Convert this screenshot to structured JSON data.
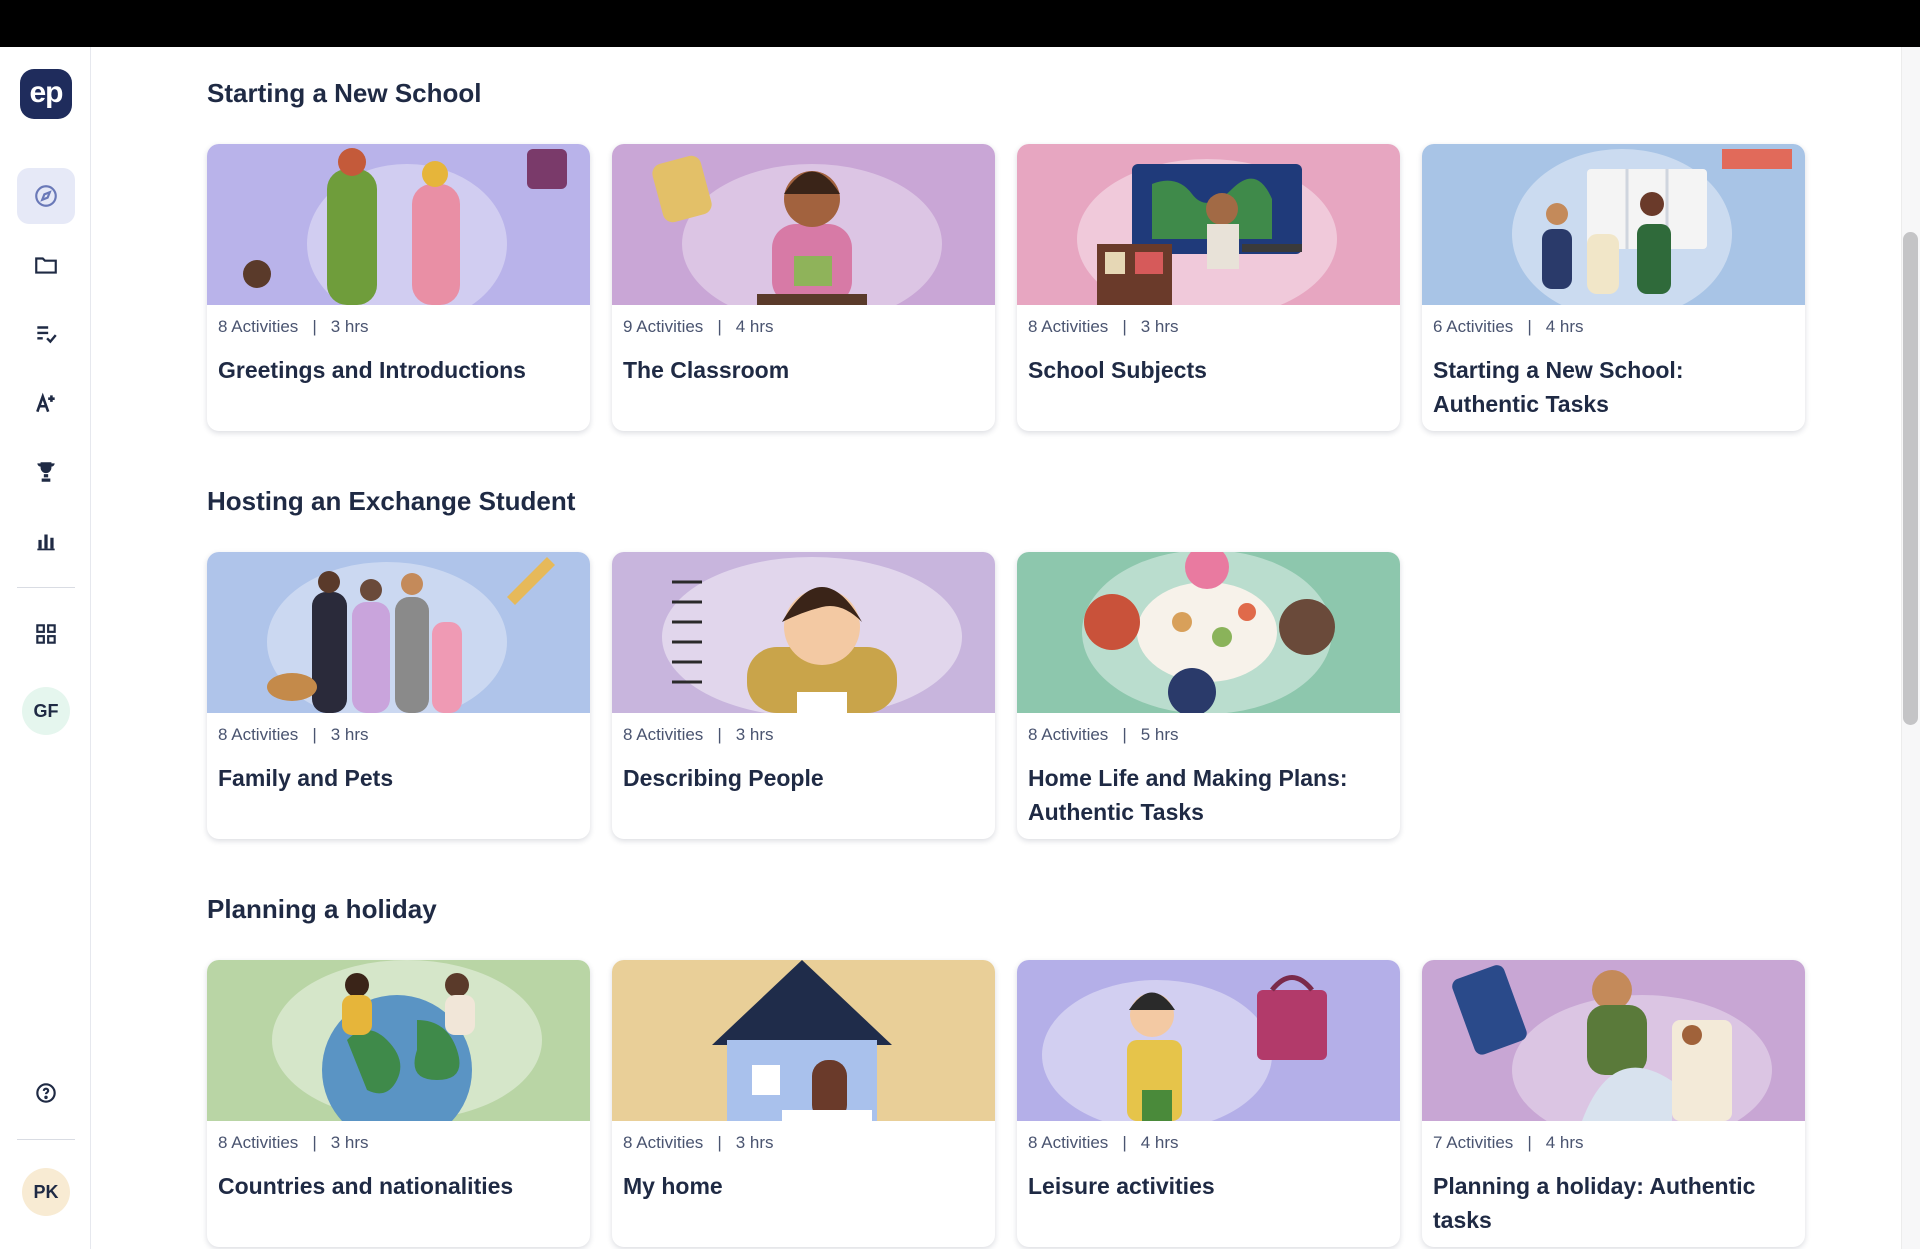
{
  "sidebar": {
    "logo": "ep",
    "nav": [
      {
        "icon": "compass-icon",
        "active": true
      },
      {
        "icon": "folder-icon",
        "active": false
      },
      {
        "icon": "checklist-icon",
        "active": false
      },
      {
        "icon": "a-plus-icon",
        "active": false
      },
      {
        "icon": "trophy-icon",
        "active": false
      },
      {
        "icon": "bar-chart-icon",
        "active": false
      },
      {
        "icon": "grid-icon",
        "active": false
      },
      {
        "icon": "help-icon",
        "active": false
      }
    ],
    "group_badge": "GF",
    "user_badge": "PK"
  },
  "sections": [
    {
      "title": "Starting a New School",
      "cards": [
        {
          "activities": "8 Activities",
          "hours": "3 hrs",
          "title": "Greetings and Introductions",
          "bg": "#b9b3ea"
        },
        {
          "activities": "9 Activities",
          "hours": "4 hrs",
          "title": "The Classroom",
          "bg": "#c9a6d6"
        },
        {
          "activities": "8 Activities",
          "hours": "3 hrs",
          "title": "School Subjects",
          "bg": "#e7a6c1"
        },
        {
          "activities": "6 Activities",
          "hours": "4 hrs",
          "title": "Starting a New School: Authentic Tasks",
          "bg": "#a8c4e6"
        }
      ]
    },
    {
      "title": "Hosting an Exchange Student",
      "cards": [
        {
          "activities": "8 Activities",
          "hours": "3 hrs",
          "title": "Family and Pets",
          "bg": "#afc4ea"
        },
        {
          "activities": "8 Activities",
          "hours": "3 hrs",
          "title": "Describing People",
          "bg": "#c8b5dd"
        },
        {
          "activities": "8 Activities",
          "hours": "5 hrs",
          "title": "Home Life and Making Plans: Authentic Tasks",
          "bg": "#8dc7ad"
        }
      ]
    },
    {
      "title": "Planning a holiday",
      "cards": [
        {
          "activities": "8 Activities",
          "hours": "3 hrs",
          "title": "Countries and nationalities",
          "bg": "#b9d5a5"
        },
        {
          "activities": "8 Activities",
          "hours": "3 hrs",
          "title": "My home",
          "bg": "#e9cf98"
        },
        {
          "activities": "8 Activities",
          "hours": "4 hrs",
          "title": "Leisure activities",
          "bg": "#b4afe8"
        },
        {
          "activities": "7 Activities",
          "hours": "4 hrs",
          "title": "Planning a holiday: Authentic tasks",
          "bg": "#c8a6d4"
        }
      ]
    }
  ]
}
